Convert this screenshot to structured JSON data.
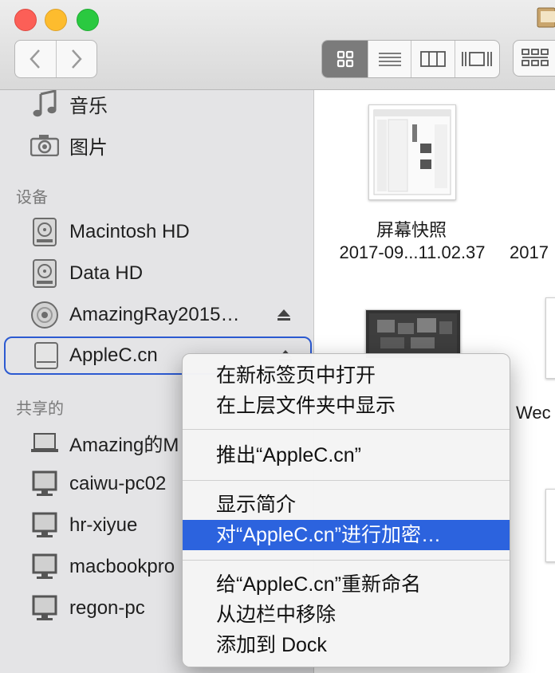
{
  "toolbar": {
    "back": "back",
    "forward": "forward",
    "views": [
      "icon-view",
      "list-view",
      "column-view",
      "cover-flow-view"
    ],
    "active_view": "icon-view"
  },
  "sidebar": {
    "favorites": [
      {
        "label": "音乐",
        "icon": "music-icon"
      },
      {
        "label": "图片",
        "icon": "camera-icon"
      }
    ],
    "devices_header": "设备",
    "devices": [
      {
        "label": "Macintosh HD",
        "icon": "hard-disk-icon"
      },
      {
        "label": "Data HD",
        "icon": "hard-disk-icon"
      },
      {
        "label": "AmazingRay2015…",
        "icon": "optical-disc-icon",
        "eject": true
      },
      {
        "label": "AppleC.cn",
        "icon": "external-drive-icon",
        "eject": true,
        "selected": true
      }
    ],
    "shared_header": "共享的",
    "shared": [
      {
        "label": "Amazing的M",
        "icon": "laptop-icon"
      },
      {
        "label": "caiwu-pc02",
        "icon": "monitor-icon"
      },
      {
        "label": "hr-xiyue",
        "icon": "monitor-icon"
      },
      {
        "label": "macbookpro",
        "icon": "monitor-icon"
      },
      {
        "label": "regon-pc",
        "icon": "monitor-icon"
      }
    ]
  },
  "content": {
    "files": [
      {
        "name_line1": "屏幕快照",
        "name_line2": "2017-09...11.02.37"
      },
      {
        "name_line2": "2017"
      },
      {
        "name_line1": "Wec"
      }
    ]
  },
  "context_menu": {
    "items": [
      {
        "label": "在新标签页中打开"
      },
      {
        "label": "在上层文件夹中显示"
      },
      {
        "label": "推出“AppleC.cn”"
      },
      {
        "label": "显示简介"
      },
      {
        "label": "对“AppleC.cn”进行加密…",
        "highlighted": true
      },
      {
        "label": "给“AppleC.cn”重新命名"
      },
      {
        "label": "从边栏中移除"
      },
      {
        "label": "添加到 Dock"
      }
    ]
  },
  "colors": {
    "selection_border": "#2c5ad1",
    "menu_highlight": "#2c63de",
    "close": "#fc5f57",
    "minimize": "#fdbc2e",
    "zoom": "#2ac940"
  }
}
